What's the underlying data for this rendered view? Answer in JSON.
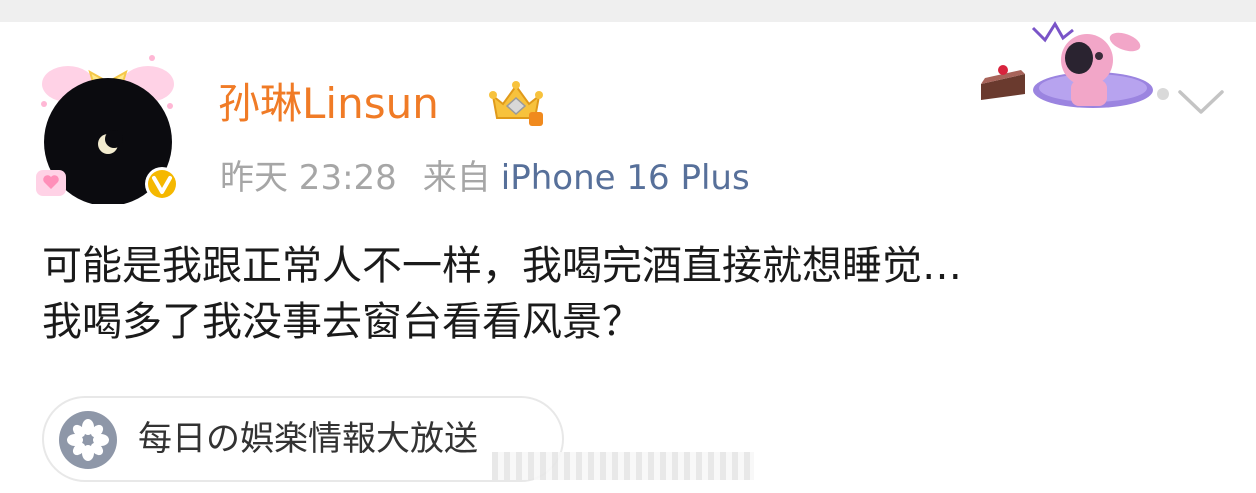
{
  "post": {
    "author": "孙琳Linsun",
    "time": "昨天 23:28",
    "source_prefix": "来自",
    "device": "iPhone 16 Plus",
    "text_lines": [
      "可能是我跟正常人不一样，我喝完酒直接就想睡觉…",
      "我喝多了我没事去窗台看看风景？"
    ],
    "topic": "每日の娯楽情報大放送"
  },
  "icons": {
    "avatar": "avatar-moon-night",
    "verified": "verified-v-badge-icon",
    "crown": "crown-membership-badge-icon",
    "more": "chevron-down-icon",
    "topic": "flower-topic-icon",
    "decoration": "card-decoration-sticker"
  },
  "colors": {
    "author": "#f07b26",
    "meta": "#a6a6a6",
    "device": "#57709a",
    "text": "#1a1a1a",
    "verified_badge": "#f5b800",
    "topic_icon_bg": "#8e97a8"
  }
}
